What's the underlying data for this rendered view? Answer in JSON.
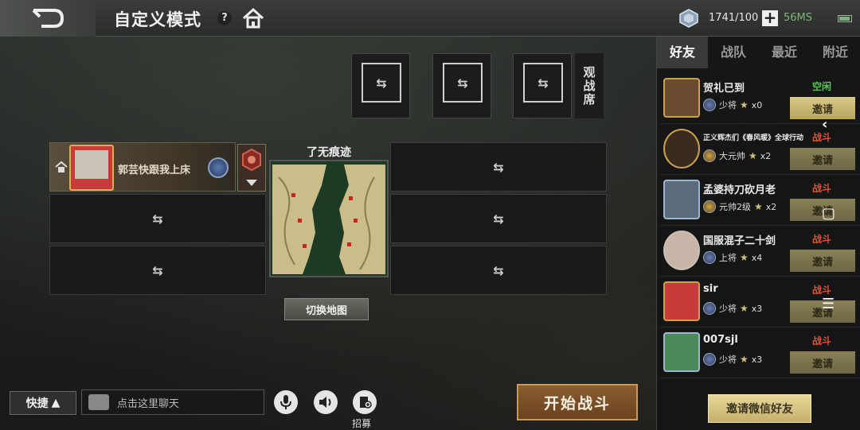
{
  "header": {
    "title": "自定义模式",
    "help_symbol": "?",
    "currency": "1741/100",
    "add_symbol": "+",
    "network": "56MS"
  },
  "spectator": {
    "label": "观战席"
  },
  "slots": {
    "swap_symbol": "⇆"
  },
  "player": {
    "name": "郭芸快跟我上床"
  },
  "map": {
    "title": "了无痕迹",
    "switch_label": "切换地图"
  },
  "friends_panel": {
    "tabs": [
      "好友",
      "战队",
      "最近",
      "附近"
    ],
    "friends": [
      {
        "name": "贺礼已到",
        "rank": "少将",
        "stars": "x0",
        "status": "空闲",
        "status_color": "#5bc45b",
        "button": "邀请"
      },
      {
        "name": "正义辉杰们《春风暖》全球行动",
        "rank": "大元帅",
        "stars": "x2",
        "status": "战斗",
        "status_color": "#e0523a",
        "button": "邀请"
      },
      {
        "name": "孟婆持刀砍月老",
        "rank": "元帅2级",
        "stars": "x2",
        "status": "战斗",
        "status_color": "#e0523a",
        "button": "邀请"
      },
      {
        "name": "国服混子二十剑",
        "rank": "上将",
        "stars": "x4",
        "status": "战斗",
        "status_color": "#e0523a",
        "button": "邀请"
      },
      {
        "name": "sir",
        "rank": "少将",
        "stars": "x3",
        "status": "战斗",
        "status_color": "#e0523a",
        "button": "邀请"
      },
      {
        "name": "007sjl",
        "rank": "少将",
        "stars": "x3",
        "status": "战斗",
        "status_color": "#e0523a",
        "button": "邀请"
      }
    ],
    "wechat_invite": "邀请微信好友"
  },
  "bottom": {
    "quick_label": "快捷",
    "quick_arrow": "▲",
    "chat_placeholder": "点击这里聊天",
    "recruit_label": "招募",
    "start_label": "开始战斗"
  },
  "system_nav": {
    "back": "‹",
    "home": "▢",
    "menu": "☰"
  }
}
